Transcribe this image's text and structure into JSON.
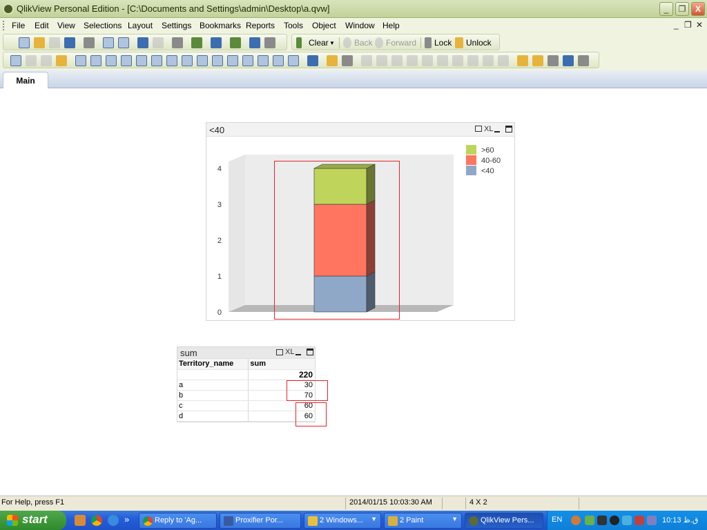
{
  "window": {
    "title": "QlikView Personal Edition - [C:\\Documents and Settings\\admin\\Desktop\\a.qvw]",
    "min_glyph": "_",
    "max_glyph": "❐",
    "close_glyph": "X"
  },
  "menu": {
    "items": [
      {
        "label": "File"
      },
      {
        "label": "Edit"
      },
      {
        "label": "View"
      },
      {
        "label": "Selections"
      },
      {
        "label": "Layout"
      },
      {
        "label": "Settings"
      },
      {
        "label": "Bookmarks"
      },
      {
        "label": "Reports"
      },
      {
        "label": "Tools"
      },
      {
        "label": "Object"
      },
      {
        "label": "Window"
      },
      {
        "label": "Help"
      }
    ],
    "doc_min": "_",
    "doc_restore": "❐",
    "doc_close": "✕"
  },
  "toolbar": {
    "clear_label": "Clear",
    "back_label": "Back",
    "forward_label": "Forward",
    "lock_label": "Lock",
    "unlock_label": "Unlock"
  },
  "tabs": [
    {
      "label": "Main"
    }
  ],
  "chart_object": {
    "caption": "<40",
    "xl_label": "XL"
  },
  "chart_data": {
    "type": "bar",
    "stacked": true,
    "style": "3d",
    "categories": [
      ""
    ],
    "series": [
      {
        "name": "<40",
        "values": [
          1
        ],
        "color": "#8fa8c8"
      },
      {
        "name": "40-60",
        "values": [
          2
        ],
        "color": "#ff7560"
      },
      {
        "name": ">60",
        "values": [
          1
        ],
        "color": "#bfd45a"
      }
    ],
    "ylim": [
      0,
      4
    ],
    "yticks": [
      "0",
      "1",
      "2",
      "3",
      "4"
    ],
    "legend_position": "top-right",
    "grid": false
  },
  "table_object": {
    "caption": "sum",
    "xl_label": "XL",
    "columns": [
      "Territory_name",
      "sum"
    ],
    "total": "220",
    "rows": [
      {
        "name": "a",
        "sum": "30"
      },
      {
        "name": "b",
        "sum": "70"
      },
      {
        "name": "c",
        "sum": "60"
      },
      {
        "name": "d",
        "sum": "60"
      }
    ]
  },
  "status": {
    "help": "For Help, press F1",
    "datetime": "2014/01/15 10:03:30 AM",
    "dims": "4 X 2"
  },
  "taskbar": {
    "start_label": "start",
    "overflow": "»",
    "buttons": [
      {
        "label": "Reply to 'Ag...",
        "dropdown": false
      },
      {
        "label": "Proxifier Por...",
        "dropdown": false
      },
      {
        "label": "2 Windows...",
        "dropdown": true
      },
      {
        "label": "2 Paint",
        "dropdown": true
      },
      {
        "label": "QlikView Pers...",
        "dropdown": false,
        "active": true
      }
    ],
    "lang": "EN",
    "clock": "10:13 ق.ظ"
  }
}
